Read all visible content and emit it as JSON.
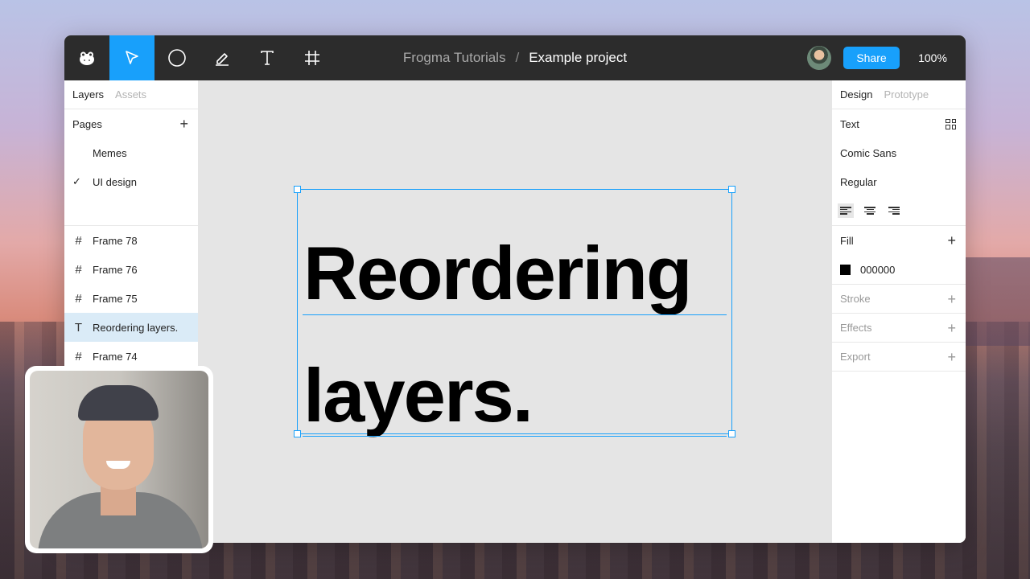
{
  "toolbar": {
    "tools": [
      {
        "name": "frog-logo-icon"
      },
      {
        "name": "move-tool-icon",
        "active": true
      },
      {
        "name": "ellipse-tool-icon"
      },
      {
        "name": "pen-tool-icon"
      },
      {
        "name": "text-tool-icon"
      },
      {
        "name": "frame-tool-icon"
      }
    ],
    "breadcrumb_root": "Frogma Tutorials",
    "breadcrumb_sep": "/",
    "breadcrumb_current": "Example project",
    "share_label": "Share",
    "zoom": "100%"
  },
  "left_panel": {
    "tab_layers": "Layers",
    "tab_assets": "Assets",
    "pages_title": "Pages",
    "pages_add": "+",
    "pages": [
      {
        "label": "Memes",
        "checked": false
      },
      {
        "label": "UI design",
        "checked": true
      }
    ],
    "layers": [
      {
        "label": "Frame 78",
        "icon": "frame-icon"
      },
      {
        "label": "Frame 76",
        "icon": "frame-icon"
      },
      {
        "label": "Frame 75",
        "icon": "frame-icon"
      },
      {
        "label": "Reordering layers.",
        "icon": "text-icon",
        "selected": true
      },
      {
        "label": "Frame 74",
        "icon": "frame-icon"
      }
    ]
  },
  "canvas": {
    "text_line1": "Reordering",
    "text_line2": "layers."
  },
  "right_panel": {
    "tab_design": "Design",
    "tab_prototype": "Prototype",
    "text_section": "Text",
    "font_family": "Comic Sans",
    "font_style": "Regular",
    "fill_section": "Fill",
    "fill_add": "+",
    "fill_hex": "000000",
    "stroke_section": "Stroke",
    "effects_section": "Effects",
    "export_section": "Export",
    "add": "+"
  },
  "colors": {
    "accent": "#18a0fb",
    "topbar": "#2c2c2c",
    "canvas": "#e5e5e5",
    "selected_layer": "#daebf7"
  }
}
